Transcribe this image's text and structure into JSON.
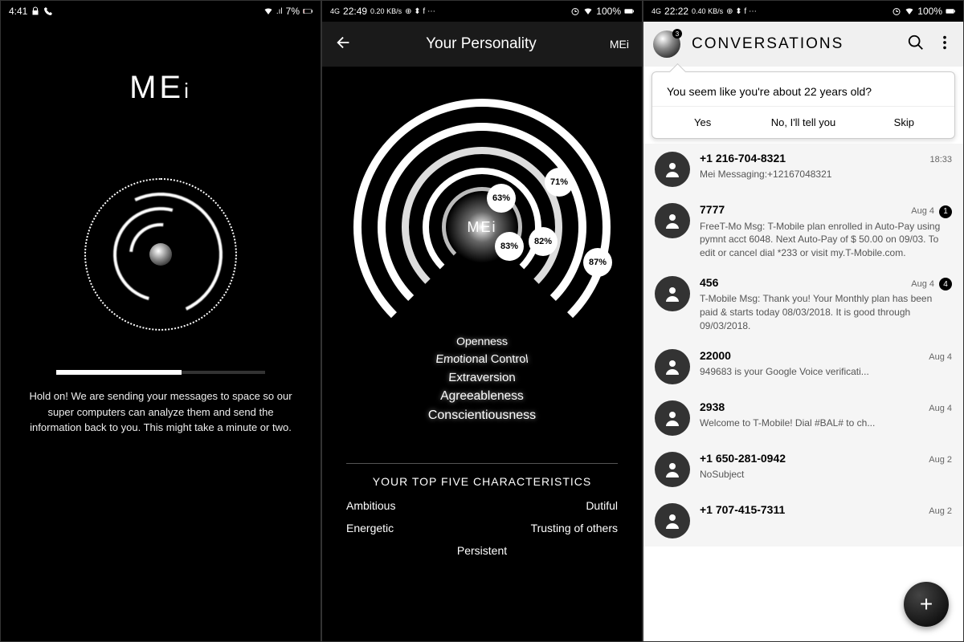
{
  "screen1": {
    "status": {
      "time": "4:41",
      "battery": "7%"
    },
    "logo": "MEi",
    "message": "Hold on! We are sending your messages to space so our super computers can analyze them and send the information back to you. This might take a minute or two."
  },
  "screen2": {
    "status": {
      "time": "22:49",
      "net_rate": "0.20 KB/s",
      "battery": "100%"
    },
    "header": {
      "title": "Your Personality",
      "brand": "MEi"
    },
    "center_label": "MEi",
    "percentages": {
      "openness": "63%",
      "emotional": "82%",
      "extraversion": "83%",
      "agreeableness": "71%",
      "conscientiousness": "87%"
    },
    "trait_labels": [
      "Openness",
      "Emotional Control",
      "Extraversion",
      "Agreeableness",
      "Conscientiousness"
    ],
    "characteristics": {
      "title": "YOUR TOP FIVE CHARACTERISTICS",
      "items": [
        "Ambitious",
        "Dutiful",
        "Energetic",
        "Trusting of others",
        "Persistent"
      ]
    }
  },
  "screen3": {
    "status": {
      "time": "22:22",
      "net_rate": "0.40 KB/s",
      "battery": "100%"
    },
    "header": {
      "title": "CONVERSATIONS",
      "orb_badge": "3"
    },
    "popup": {
      "question": "You seem like you're about 22 years old?",
      "yes": "Yes",
      "no": "No, I'll tell you",
      "skip": "Skip"
    },
    "conversations": [
      {
        "name": "+1 216-704-8321",
        "time": "18:33",
        "msg": "Mei Messaging:+12167048321",
        "unread": null
      },
      {
        "name": "7777",
        "time": "Aug 4",
        "msg": "FreeT-Mo Msg: T-Mobile plan enrolled in Auto-Pay using pymnt acct 6048. Next Auto-Pay of $ 50.00 on 09/03. To edit or cancel dial *233 or visit my.T-Mobile.com.",
        "unread": "1"
      },
      {
        "name": "456",
        "time": "Aug 4",
        "msg": "T-Mobile Msg: Thank you! Your Monthly plan has been paid & starts today 08/03/2018. It is good through 09/03/2018.",
        "unread": "4"
      },
      {
        "name": "22000",
        "time": "Aug 4",
        "msg": "949683 is your Google Voice verificati...",
        "unread": null
      },
      {
        "name": "2938",
        "time": "Aug 4",
        "msg": "Welcome to T-Mobile! Dial #BAL# to ch...",
        "unread": null
      },
      {
        "name": "+1 650-281-0942",
        "time": "Aug 2",
        "msg": "NoSubject",
        "unread": null
      },
      {
        "name": "+1 707-415-7311",
        "time": "Aug 2",
        "msg": "",
        "unread": null
      }
    ]
  },
  "chart_data": {
    "type": "bar",
    "title": "Your Personality",
    "categories": [
      "Openness",
      "Emotional Control",
      "Extraversion",
      "Agreeableness",
      "Conscientiousness"
    ],
    "values": [
      63,
      82,
      83,
      71,
      87
    ],
    "ylim": [
      0,
      100
    ],
    "ylabel": "%"
  }
}
